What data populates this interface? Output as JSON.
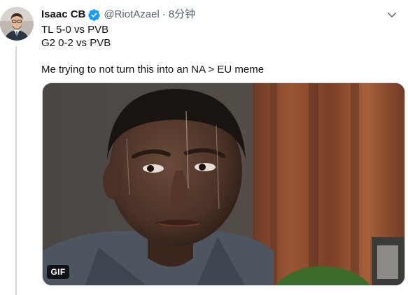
{
  "tweet": {
    "author": {
      "display_name": "Isaac CB",
      "handle": "@RiotAzael",
      "verified": true
    },
    "separator": "·",
    "timestamp": "8分钟",
    "lines": [
      "TL 5-0 vs PVB",
      "G2 0-2 vs PVB",
      "",
      "Me trying to not turn this into an NA > EU meme"
    ],
    "media": {
      "badge": "GIF"
    }
  },
  "colors": {
    "text": "#0f1419",
    "secondary": "#536471",
    "verified": "#1d9bf0",
    "thread_line": "#cfd9de"
  },
  "icons": {
    "verified": "verified-badge-icon",
    "more": "chevron-down-icon"
  }
}
